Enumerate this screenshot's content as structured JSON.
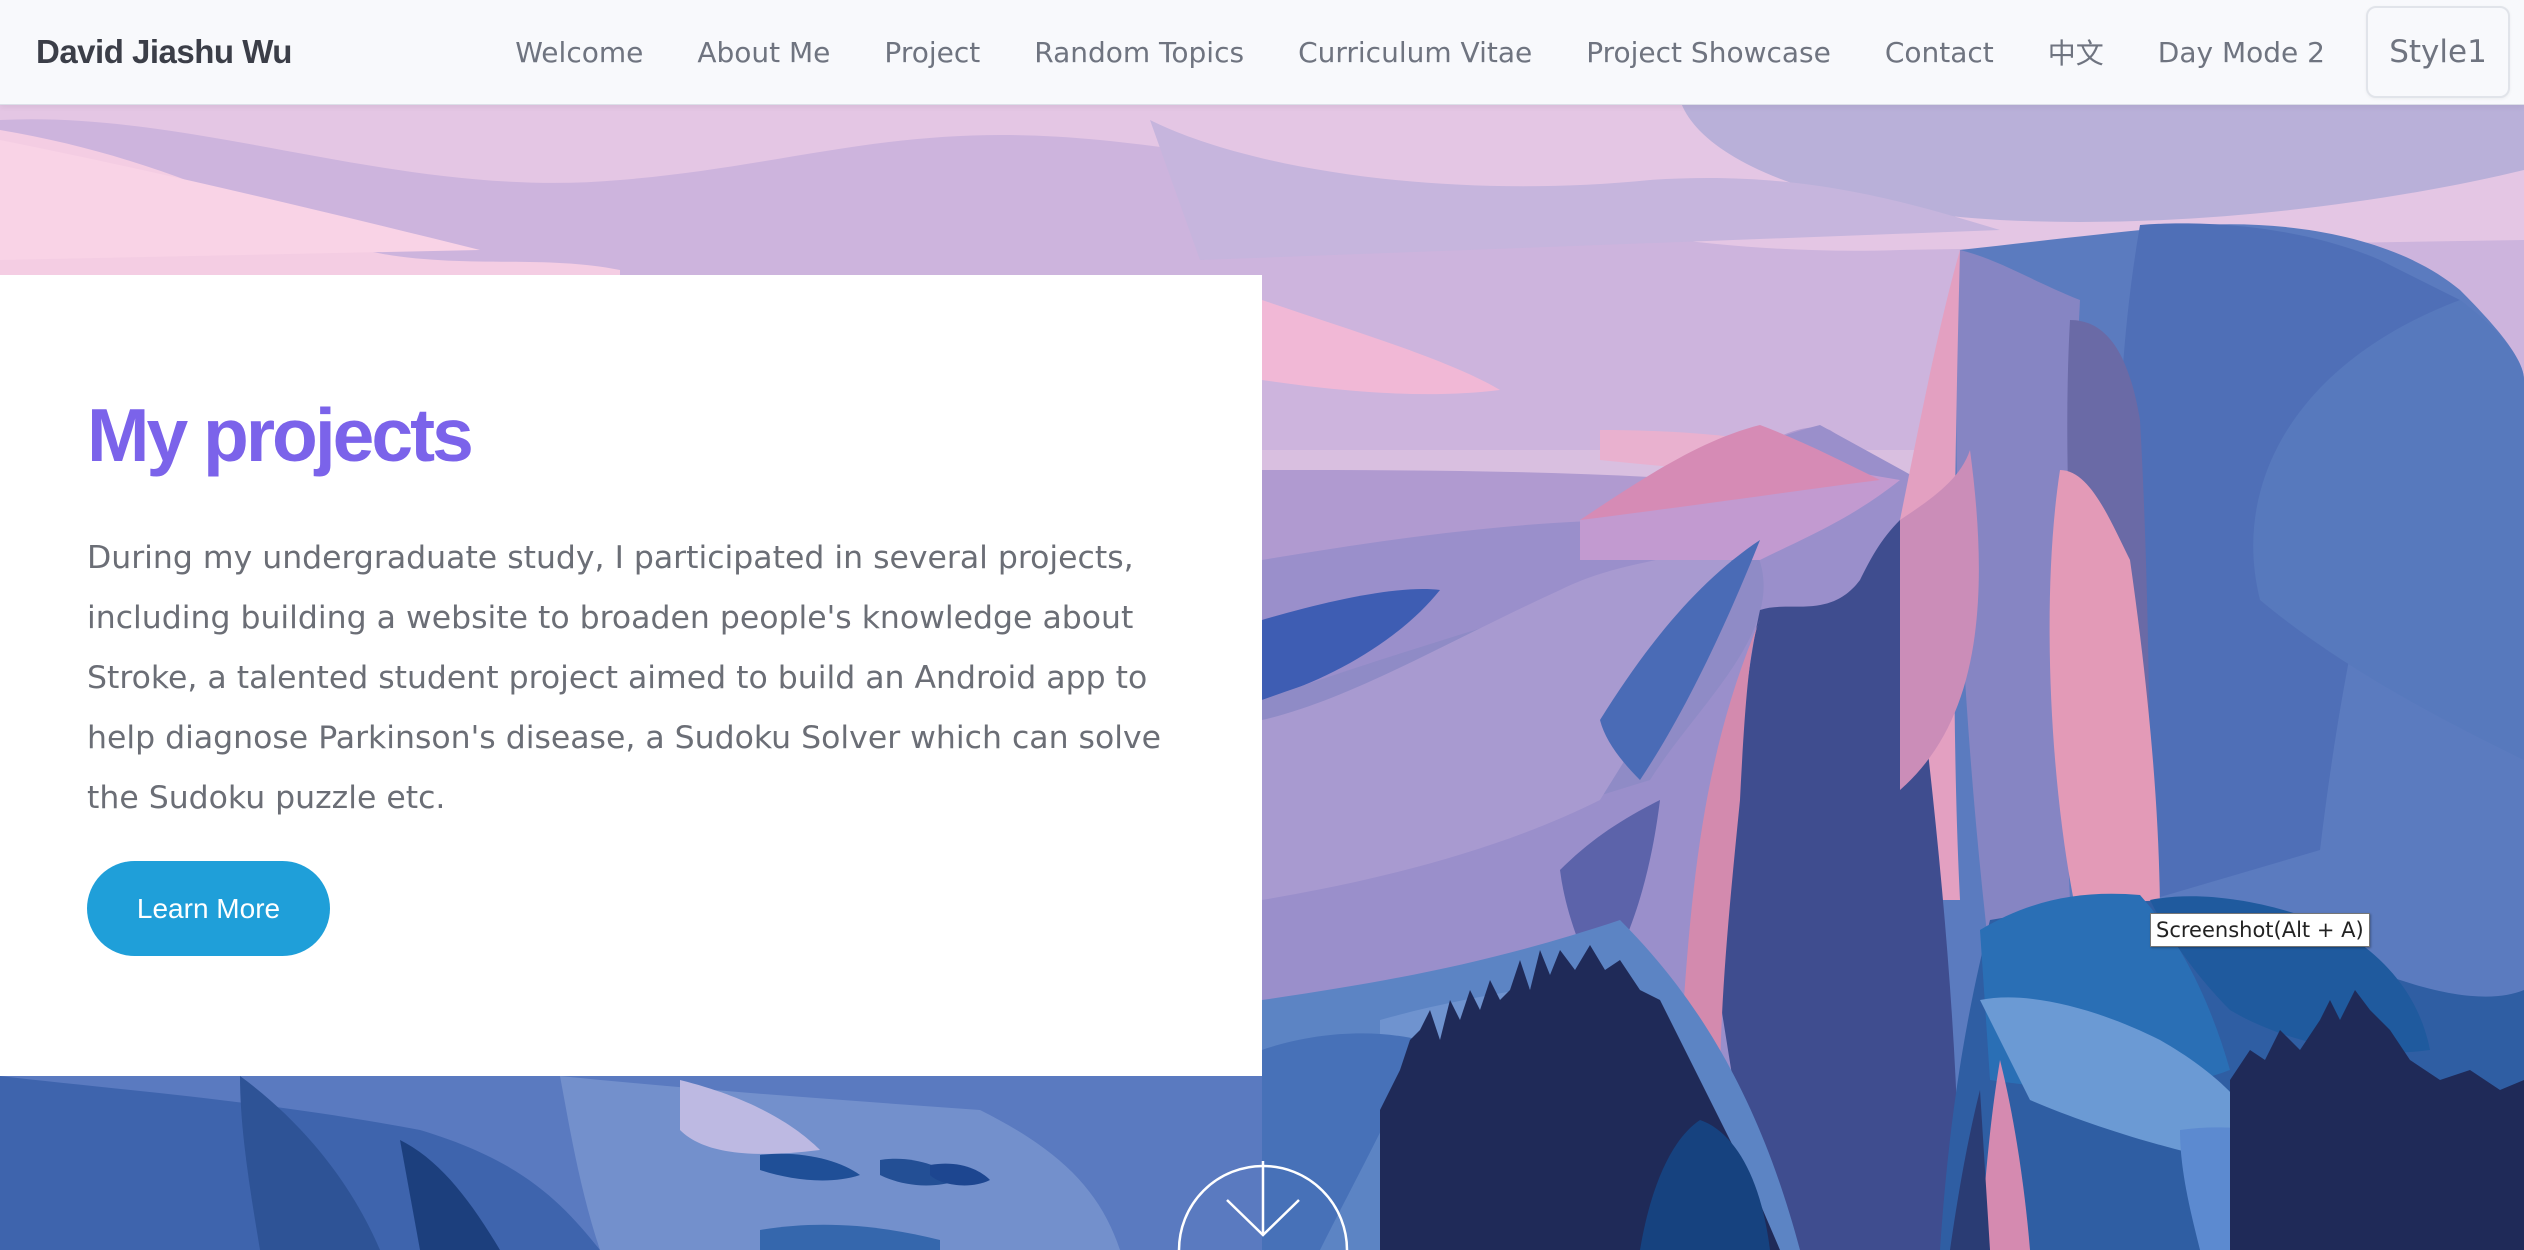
{
  "brand": "David Jiashu Wu",
  "nav": {
    "items": [
      "Welcome",
      "About Me",
      "Project",
      "Random Topics",
      "Curriculum Vitae",
      "Project Showcase",
      "Contact",
      "中文",
      "Day Mode 2"
    ],
    "style_button": "Style1"
  },
  "hero": {
    "title": "My projects",
    "description": "During my undergraduate study, I participated in several projects, including building a website to broaden people's knowledge about Stroke, a talented student project aimed to build an Android app to help diagnose Parkinson's disease, a Sudoku Solver which can solve the Sudoku puzzle etc.",
    "button_label": "Learn More"
  },
  "tooltip": "Screenshot(Alt + A)",
  "icons": {
    "scroll_down": "arrow-down-circle-icon"
  },
  "colors": {
    "title": "#7b63ea",
    "button": "#1f9fd9",
    "sky_light": "#e6c7e2",
    "cliff_blue": "#5577b8",
    "cliff_pink": "#e39ab7",
    "trees_dark": "#1f2a58"
  }
}
